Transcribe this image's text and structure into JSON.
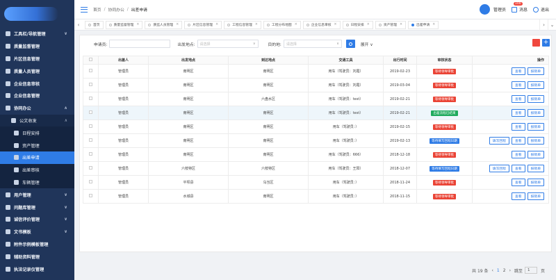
{
  "sidebar": {
    "items": [
      {
        "label": "工具栏/导航管理",
        "level": 0,
        "chev": "∨"
      },
      {
        "label": "质量监督管理",
        "level": 0,
        "chev": ""
      },
      {
        "label": "片区信息管理",
        "level": 0,
        "chev": ""
      },
      {
        "label": "质量人员管理",
        "level": 0,
        "chev": ""
      },
      {
        "label": "企业信息审核",
        "level": 0,
        "chev": ""
      },
      {
        "label": "企业信息管理",
        "level": 0,
        "chev": ""
      },
      {
        "label": "协同办公",
        "level": 0,
        "chev": "∧"
      },
      {
        "label": "公文收发",
        "level": 1,
        "chev": "∧"
      },
      {
        "label": "日程安排",
        "level": 2,
        "chev": ""
      },
      {
        "label": "资产管理",
        "level": 2,
        "chev": ""
      },
      {
        "label": "出差申请",
        "level": 2,
        "chev": "",
        "active": true
      },
      {
        "label": "出差审核",
        "level": 2,
        "chev": ""
      },
      {
        "label": "车辆管理",
        "level": 2,
        "chev": ""
      },
      {
        "label": "用户管理",
        "level": 0,
        "chev": "∨"
      },
      {
        "label": "问题库管理",
        "level": 0,
        "chev": "∨"
      },
      {
        "label": "诚信评价管理",
        "level": 0,
        "chev": "∨"
      },
      {
        "label": "文书模板",
        "level": 0,
        "chev": "∨"
      },
      {
        "label": "附件示例模板管理",
        "level": 0,
        "chev": ""
      },
      {
        "label": "辅助资料管理",
        "level": 0,
        "chev": ""
      },
      {
        "label": "执法记录仪管理",
        "level": 0,
        "chev": ""
      }
    ]
  },
  "header": {
    "breadcrumb": [
      "首页",
      "协同办公",
      "出差申请"
    ],
    "user": "管理员",
    "messages_label": "消息",
    "messages_badge": "100",
    "logout": "退出"
  },
  "tabs": [
    {
      "label": "首页",
      "active": false
    },
    {
      "label": "质量监督管理",
      "active": false
    },
    {
      "label": "质监人员管理",
      "active": false
    },
    {
      "label": "片区信息管理",
      "active": false
    },
    {
      "label": "工程信息管理",
      "active": false
    },
    {
      "label": "工程分布地图",
      "active": false
    },
    {
      "label": "企业信息审核",
      "active": false
    },
    {
      "label": "日程安排",
      "active": false
    },
    {
      "label": "资产管理",
      "active": false
    },
    {
      "label": "出差申请",
      "active": true
    }
  ],
  "filters": {
    "applicant_label": "申请员:",
    "from_label": "出发地点:",
    "from_placeholder": "请选择",
    "to_label": "目的地:",
    "to_placeholder": "请选择",
    "expand_label": "展开"
  },
  "table": {
    "headers": [
      "出差人",
      "出发地点",
      "到达地点",
      "交通工具",
      "出行时间",
      "审核状态",
      "操作"
    ],
    "rows": [
      {
        "person": "管理员",
        "from": "南明区",
        "to": "南明区",
        "transport": "用车（驾驶员：刘霞）",
        "date": "2019-02-23",
        "status": "等待领导审批",
        "color": "red",
        "ops": [
          "查看",
          "报销单"
        ],
        "hl": false
      },
      {
        "person": "管理员",
        "from": "南明区",
        "to": "南明区",
        "transport": "用车（驾驶员：刘霞）",
        "date": "2019-03-04",
        "status": "等待领导审批",
        "color": "red",
        "ops": [
          "查看",
          "报销单"
        ],
        "hl": false
      },
      {
        "person": "管理员",
        "from": "南明区",
        "to": "六盘水区",
        "transport": "用车（驾驶员：test）",
        "date": "2019-02-21",
        "status": "等待领导审批",
        "color": "red",
        "ops": [
          "查看",
          "报销单"
        ],
        "hl": false
      },
      {
        "person": "管理员",
        "from": "南明区",
        "to": "南明区",
        "transport": "用车（驾驶员：test）",
        "date": "2019-02-21",
        "status": "出差流程已结束",
        "color": "green",
        "ops": [
          "查看",
          "报销单"
        ],
        "hl": true
      },
      {
        "person": "管理员",
        "from": "南明区",
        "to": "南明区",
        "transport": "用车（驾驶员：）",
        "date": "2019-02-15",
        "status": "等待领导审批",
        "color": "red",
        "ops": [
          "查看",
          "报销单"
        ],
        "hl": false
      },
      {
        "person": "管理员",
        "from": "南明区",
        "to": "南明区",
        "transport": "用车（驾驶员：）",
        "date": "2019-02-13",
        "status": "等待填写回程日期",
        "color": "blue",
        "ops": [
          "填写回程",
          "查看",
          "报销单"
        ],
        "hl": false
      },
      {
        "person": "管理员",
        "from": "南明区",
        "to": "南明区",
        "transport": "用车（驾驶员：666）",
        "date": "2018-12-18",
        "status": "等待领导审批",
        "color": "red",
        "ops": [
          "查看",
          "报销单"
        ],
        "hl": false
      },
      {
        "person": "管理员",
        "from": "六枝特区",
        "to": "六枝特区",
        "transport": "用车（驾驶员：王阳）",
        "date": "2018-12-07",
        "status": "等待填写回程日期",
        "color": "blue",
        "ops": [
          "填写回程",
          "查看",
          "报销单"
        ],
        "hl": false
      },
      {
        "person": "管理员",
        "from": "平坝县",
        "to": "乌当区",
        "transport": "用车（驾驶员：）",
        "date": "2018-11-24",
        "status": "等待领导审批",
        "color": "red",
        "ops": [
          "查看",
          "报销单"
        ],
        "hl": false
      },
      {
        "person": "管理员",
        "from": "水城县",
        "to": "南明区",
        "transport": "用车（驾驶员：）",
        "date": "2018-11-15",
        "status": "等待领导审批",
        "color": "red",
        "ops": [
          "查看",
          "报销单"
        ],
        "hl": false
      }
    ]
  },
  "pager": {
    "total": "共 19 条",
    "prev": "‹",
    "pages": [
      "1",
      "2"
    ],
    "next": "›",
    "jump_label": "跳至",
    "jump_value": "1",
    "unit": "页"
  }
}
